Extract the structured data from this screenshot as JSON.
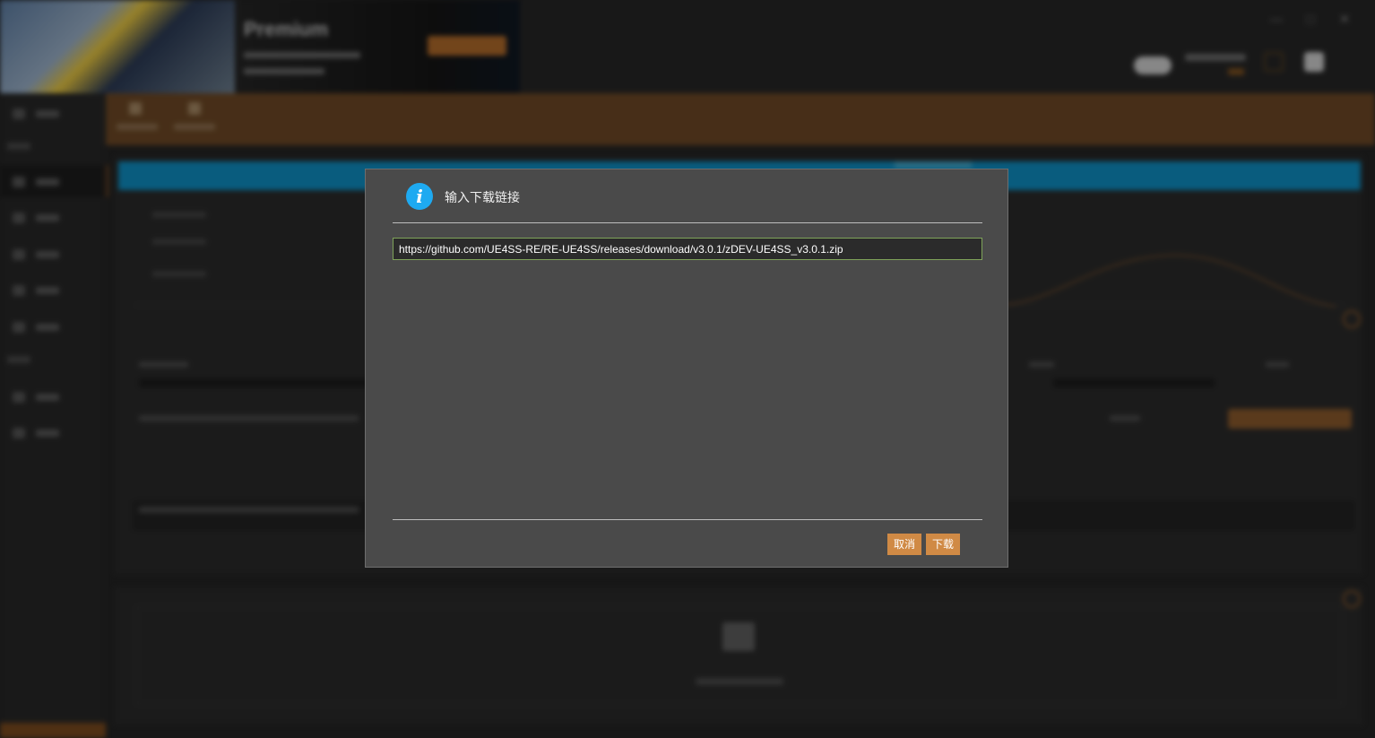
{
  "banner": {
    "ad_title": "Premium"
  },
  "dialog": {
    "title": "输入下载链接",
    "icon": "info-icon",
    "url_value": "https://github.com/UE4SS-RE/RE-UE4SS/releases/download/v3.0.1/zDEV-UE4SS_v3.0.1.zip",
    "cancel_label": "取消",
    "download_label": "下载"
  },
  "colors": {
    "accent": "#d08a45",
    "info_icon": "#1eaaf1",
    "input_border": "#7fa35a",
    "toolbar": "#6d4825",
    "banner_bar": "#0f8ec2"
  }
}
